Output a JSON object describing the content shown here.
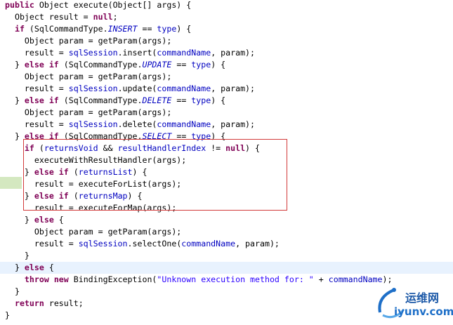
{
  "editor": {
    "lines": [
      [
        [
          "kw",
          "public"
        ],
        [
          "t",
          " Object execute(Object[] args) {"
        ]
      ],
      [
        [
          "t",
          "  Object result = "
        ],
        [
          "kw",
          "null"
        ],
        [
          "t",
          ";"
        ]
      ],
      [
        [
          "t",
          "  "
        ],
        [
          "kw",
          "if"
        ],
        [
          "t",
          " (SqlCommandType."
        ],
        [
          "cst",
          "INSERT"
        ],
        [
          "t",
          " == "
        ],
        [
          "fld",
          "type"
        ],
        [
          "t",
          ") {"
        ]
      ],
      [
        [
          "t",
          "    Object param = getParam(args);"
        ]
      ],
      [
        [
          "t",
          "    result = "
        ],
        [
          "fld",
          "sqlSession"
        ],
        [
          "t",
          ".insert("
        ],
        [
          "fld",
          "commandName"
        ],
        [
          "t",
          ", param);"
        ]
      ],
      [
        [
          "t",
          "  } "
        ],
        [
          "kw",
          "else"
        ],
        [
          "t",
          " "
        ],
        [
          "kw",
          "if"
        ],
        [
          "t",
          " (SqlCommandType."
        ],
        [
          "cst",
          "UPDATE"
        ],
        [
          "t",
          " == "
        ],
        [
          "fld",
          "type"
        ],
        [
          "t",
          ") {"
        ]
      ],
      [
        [
          "t",
          "    Object param = getParam(args);"
        ]
      ],
      [
        [
          "t",
          "    result = "
        ],
        [
          "fld",
          "sqlSession"
        ],
        [
          "t",
          ".update("
        ],
        [
          "fld",
          "commandName"
        ],
        [
          "t",
          ", param);"
        ]
      ],
      [
        [
          "t",
          "  } "
        ],
        [
          "kw",
          "else"
        ],
        [
          "t",
          " "
        ],
        [
          "kw",
          "if"
        ],
        [
          "t",
          " (SqlCommandType."
        ],
        [
          "cst",
          "DELETE"
        ],
        [
          "t",
          " == "
        ],
        [
          "fld",
          "type"
        ],
        [
          "t",
          ") {"
        ]
      ],
      [
        [
          "t",
          "    Object param = getParam(args);"
        ]
      ],
      [
        [
          "t",
          "    result = "
        ],
        [
          "fld",
          "sqlSession"
        ],
        [
          "t",
          ".delete("
        ],
        [
          "fld",
          "commandName"
        ],
        [
          "t",
          ", param);"
        ]
      ],
      [
        [
          "t",
          "  } "
        ],
        [
          "kw",
          "else"
        ],
        [
          "t",
          " "
        ],
        [
          "kw",
          "if"
        ],
        [
          "t",
          " (SqlCommandType."
        ],
        [
          "cst",
          "SELECT"
        ],
        [
          "t",
          " == "
        ],
        [
          "fld",
          "type"
        ],
        [
          "t",
          ") {"
        ]
      ],
      [
        [
          "t",
          "    "
        ],
        [
          "kw",
          "if"
        ],
        [
          "t",
          " ("
        ],
        [
          "fld",
          "returnsVoid"
        ],
        [
          "t",
          " && "
        ],
        [
          "fld",
          "resultHandlerIndex"
        ],
        [
          "t",
          " != "
        ],
        [
          "kw",
          "null"
        ],
        [
          "t",
          ") {"
        ]
      ],
      [
        [
          "t",
          "      executeWithResultHandler(args);"
        ]
      ],
      [
        [
          "t",
          "    } "
        ],
        [
          "kw",
          "else"
        ],
        [
          "t",
          " "
        ],
        [
          "kw",
          "if"
        ],
        [
          "t",
          " ("
        ],
        [
          "fld",
          "returnsList"
        ],
        [
          "t",
          ") {"
        ]
      ],
      [
        [
          "t",
          "      result = executeForList(args);"
        ]
      ],
      [
        [
          "t",
          "    } "
        ],
        [
          "kw",
          "else"
        ],
        [
          "t",
          " "
        ],
        [
          "kw",
          "if"
        ],
        [
          "t",
          " ("
        ],
        [
          "fld",
          "returnsMap"
        ],
        [
          "t",
          ") {"
        ]
      ],
      [
        [
          "t",
          "      result = executeForMap(args);"
        ]
      ],
      [
        [
          "t",
          "    } "
        ],
        [
          "kw",
          "else"
        ],
        [
          "t",
          " {"
        ]
      ],
      [
        [
          "t",
          "      Object param = getParam(args);"
        ]
      ],
      [
        [
          "t",
          "      result = "
        ],
        [
          "fld",
          "sqlSession"
        ],
        [
          "t",
          ".selectOne("
        ],
        [
          "fld",
          "commandName"
        ],
        [
          "t",
          ", param);"
        ]
      ],
      [
        [
          "t",
          "    }"
        ]
      ],
      [
        [
          "t",
          "  } "
        ],
        [
          "kw",
          "else"
        ],
        [
          "t",
          " {"
        ]
      ],
      [
        [
          "t",
          "    "
        ],
        [
          "kw",
          "throw"
        ],
        [
          "t",
          " "
        ],
        [
          "kw",
          "new"
        ],
        [
          "t",
          " BindingException("
        ],
        [
          "str",
          "\"Unknown execution method for: \""
        ],
        [
          "t",
          " + "
        ],
        [
          "fld",
          "commandName"
        ],
        [
          "t",
          ");"
        ]
      ],
      [
        [
          "t",
          "  }"
        ]
      ],
      [
        [
          "t",
          "  "
        ],
        [
          "kw",
          "return"
        ],
        [
          "t",
          " result;"
        ]
      ],
      [
        [
          "t",
          "}"
        ]
      ]
    ],
    "current_line_index": 22,
    "highlighted_line_index": 15
  },
  "watermark": {
    "brand": "运维网",
    "url": "iyunv.com"
  },
  "colors": {
    "keyword": "#7f0055",
    "field": "#0000c0",
    "string": "#2a00ff",
    "highlight_box": "#d23a3a",
    "current_line": "#e8f2fe"
  }
}
